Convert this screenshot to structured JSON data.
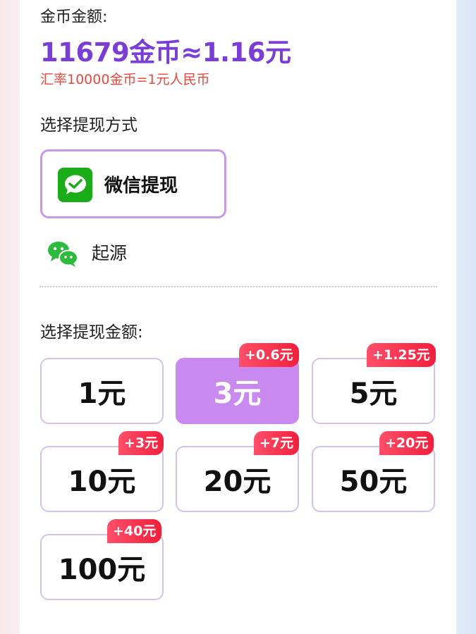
{
  "coins": {
    "label": "金币金额:",
    "amount_text": "11679金币≈1.16元",
    "rate_text": "汇率10000金币=1元人民币"
  },
  "method": {
    "title": "选择提现方式",
    "option_label": "微信提现",
    "option_icon": "wechat-pay-icon",
    "account_icon": "wechat-icon",
    "account_name": "起源"
  },
  "amounts": {
    "title": "选择提现金额:",
    "items": [
      {
        "label": "1元",
        "bonus": ""
      },
      {
        "label": "3元",
        "bonus": "+0.6元",
        "selected": true
      },
      {
        "label": "5元",
        "bonus": "+1.25元"
      },
      {
        "label": "10元",
        "bonus": "+3元"
      },
      {
        "label": "20元",
        "bonus": "+7元"
      },
      {
        "label": "50元",
        "bonus": "+20元"
      },
      {
        "label": "100元",
        "bonus": "+40元"
      }
    ]
  },
  "colors": {
    "accent_purple": "#7a3ed6",
    "selected_bg": "#c989ee",
    "rate_red": "#e9483f",
    "bonus_red": "#f21f3c",
    "wechat_green": "#1aad19"
  }
}
